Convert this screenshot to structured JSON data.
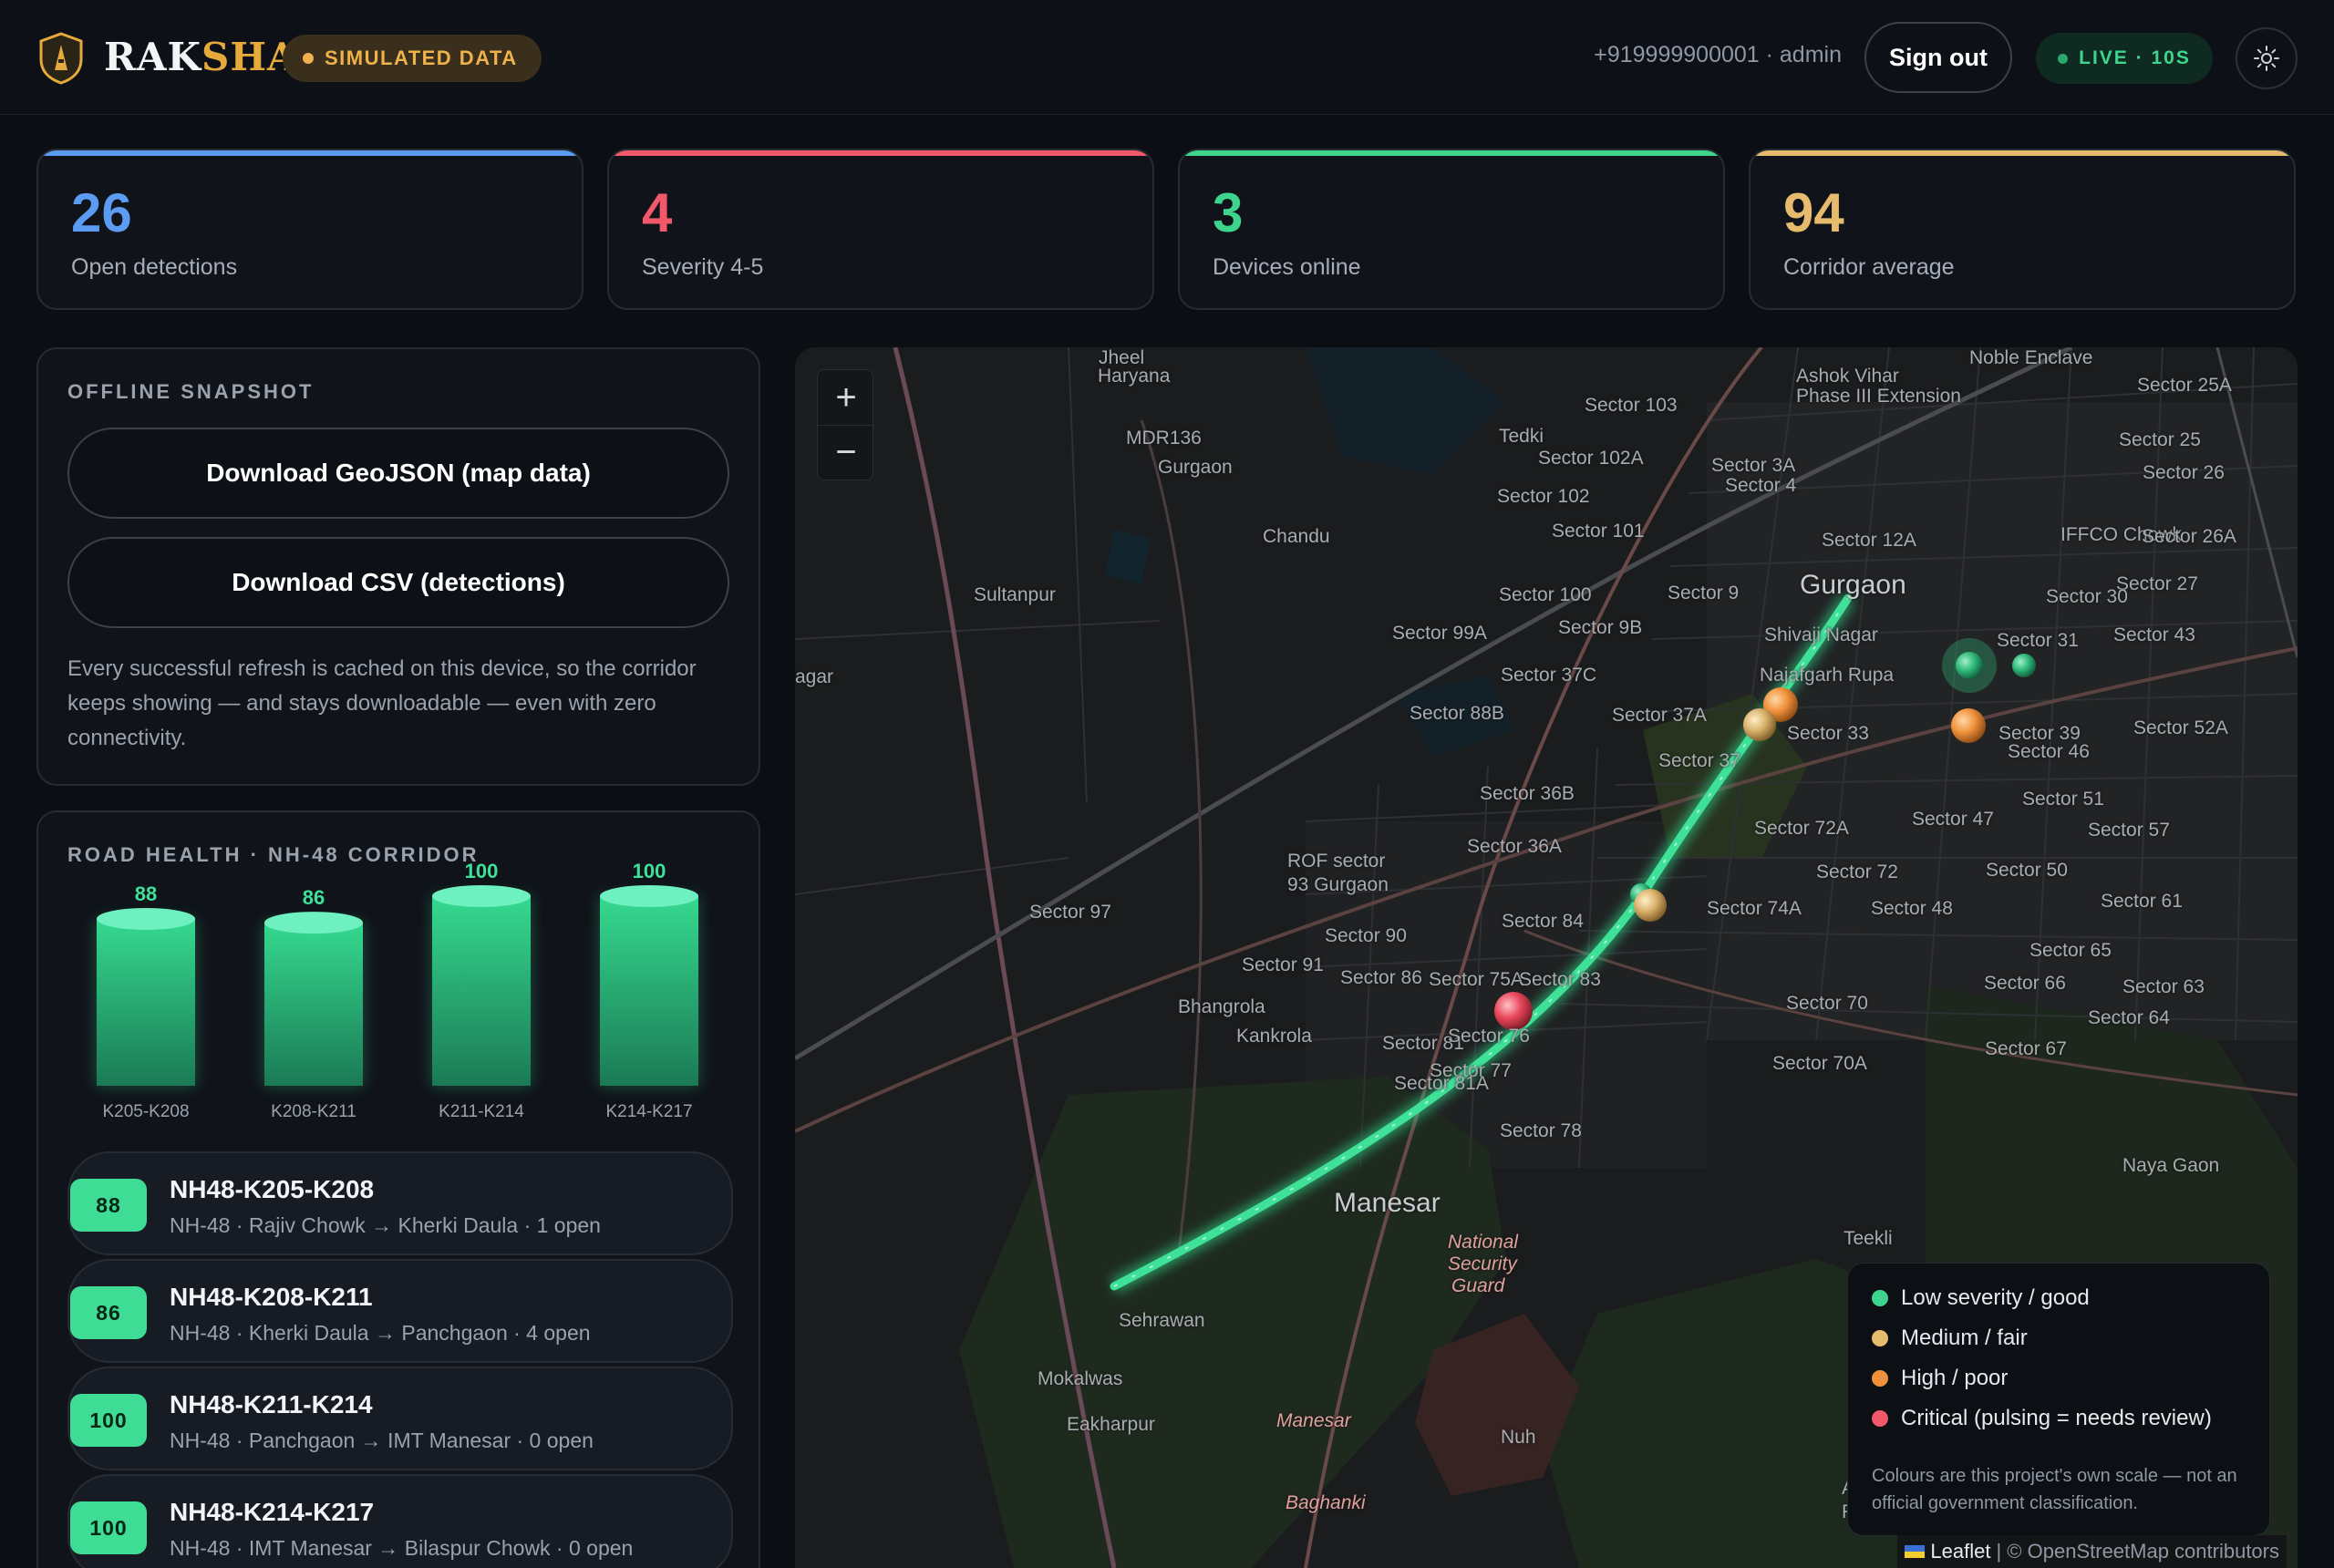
{
  "header": {
    "brand_part1": "RAK",
    "brand_part2": "SHA",
    "sim_label": "SIMULATED DATA",
    "user": "+919999900001 · admin",
    "signout_label": "Sign out",
    "live_label": "LIVE · 10S",
    "theme_icon": "sun-icon"
  },
  "stats": [
    {
      "value": "26",
      "label": "Open detections",
      "color": "#5b9cf2"
    },
    {
      "value": "4",
      "label": "Severity 4-5",
      "color": "#f1586a"
    },
    {
      "value": "3",
      "label": "Devices online",
      "color": "#3fd48d"
    },
    {
      "value": "94",
      "label": "Corridor average",
      "color": "#e6bb6d"
    }
  ],
  "offline": {
    "title": "OFFLINE SNAPSHOT",
    "geojson_label": "Download GeoJSON (map data)",
    "csv_label": "Download CSV (detections)",
    "note": "Every successful refresh is cached on this device, so the corridor keeps showing — and stays downloadable — even with zero connectivity."
  },
  "road_health": {
    "title": "ROAD HEALTH · NH-48 CORRIDOR"
  },
  "chart_data": {
    "type": "bar",
    "categories": [
      "K205-K208",
      "K208-K211",
      "K211-K214",
      "K214-K217"
    ],
    "values": [
      88,
      86,
      100,
      100
    ],
    "title": "ROAD HEALTH · NH-48 CORRIDOR",
    "ylim": [
      0,
      100
    ]
  },
  "segments": [
    {
      "score": "88",
      "name": "NH48-K205-K208",
      "detail": "NH-48 · Rajiv Chowk → Kherki Daula · 1 open"
    },
    {
      "score": "86",
      "name": "NH48-K208-K211",
      "detail": "NH-48 · Kherki Daula → Panchgaon · 4 open"
    },
    {
      "score": "100",
      "name": "NH48-K211-K214",
      "detail": "NH-48 · Panchgaon → IMT Manesar · 0 open"
    },
    {
      "score": "100",
      "name": "NH48-K214-K217",
      "detail": "NH-48 · IMT Manesar → Bilaspur Chowk · 0 open"
    }
  ],
  "map": {
    "zoom_in": "+",
    "zoom_out": "−",
    "legend": [
      {
        "label": "Low severity / good",
        "color": "#3fd48d"
      },
      {
        "label": "Medium / fair",
        "color": "#e6bb6d"
      },
      {
        "label": "High / poor",
        "color": "#f0913a"
      },
      {
        "label": "Critical (pulsing = needs review)",
        "color": "#f1586a"
      }
    ],
    "legend_note": "Colours are this project's own scale — not an official government classification.",
    "attribution_leaflet": "Leaflet",
    "attribution_osm": "| © OpenStreetMap contributors",
    "labels": [
      "Ashok Vihar",
      "Phase III Extension",
      "Noble Enclave",
      "Sector 25A",
      "Sector 103",
      "Tedki",
      "MDR136",
      "Sector 102A",
      "Sector 3A",
      "Sector 25",
      "Sector 26",
      "Sector 4",
      "Sector 102",
      "Chandu",
      "IFFCO Chowk",
      "Sector 26A",
      "Sector 12A",
      "Sector 101",
      "Gurgaon",
      "Sector 27",
      "Sultanpur",
      "Sector 100",
      "Sector 9",
      "Sector 30",
      "Sector 99A",
      "Sector 9B",
      "Shivaji Nagar",
      "Sector 31",
      "Sector 43",
      "agar",
      "Sector 37C",
      "Najafgarh Rupa",
      "Sector 88B",
      "Sector 37A",
      "Sector 33",
      "Sector 39",
      "Sector 52A",
      "Sector 46",
      "Sector 37",
      "Sector 36B",
      "Sector 51",
      "Sector 47",
      "Sector 72A",
      "Sector 57",
      "Sector 36A",
      "ROF sector",
      "93 Gurgaon",
      "Sector 72",
      "Sector 50",
      "Sector 97",
      "Sector 74A",
      "Sector 48",
      "Sector 61",
      "Sector 84",
      "Sector 90",
      "Sector 65",
      "Sector 91",
      "Sector 75A",
      "Sector 86",
      "Sector 83",
      "Sector 66",
      "Sector 63",
      "Bhangrola",
      "Kankrola",
      "Sector 70",
      "Sector 64",
      "Sector 81",
      "Sector 76",
      "Sector 77",
      "Sector 67",
      "Sector 81A",
      "Sector 70A",
      "Sector 78",
      "Naya Gaon",
      "Manesar",
      "Teekli",
      "National",
      "Security",
      "Guard",
      "Sehrawan",
      "Mokalwas",
      "Eakharpur",
      "Manesar",
      "Baghanki",
      "Nuh",
      "Aravali",
      "Retreat",
      "Jheel",
      "Haryana",
      "Gurgaon"
    ]
  }
}
